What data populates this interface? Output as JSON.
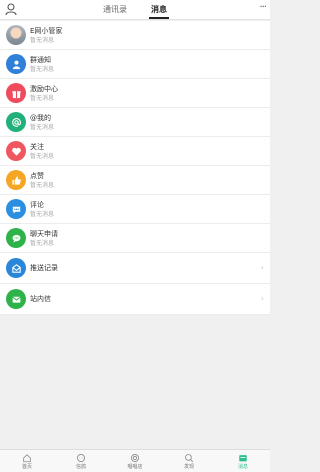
{
  "header": {
    "tabs": [
      {
        "label": "通讯录",
        "active": false
      },
      {
        "label": "消息",
        "active": true
      }
    ],
    "more_label": "···"
  },
  "messages": [
    {
      "title": "E网小管家",
      "subtitle": "暂无消息",
      "icon": "user-photo",
      "color": "#8a949e"
    },
    {
      "title": "群通知",
      "subtitle": "暂无消息",
      "icon": "group-icon",
      "color": "#2f80d8"
    },
    {
      "title": "激励中心",
      "subtitle": "暂无消息",
      "icon": "gift-icon",
      "color": "#ef4b5c"
    },
    {
      "title": "@我的",
      "subtitle": "暂无消息",
      "icon": "at-icon",
      "color": "#22b07a"
    },
    {
      "title": "关注",
      "subtitle": "暂无消息",
      "icon": "heart-icon",
      "color": "#f0565f"
    },
    {
      "title": "点赞",
      "subtitle": "暂无消息",
      "icon": "thumbs-up-icon",
      "color": "#f5a623"
    },
    {
      "title": "评论",
      "subtitle": "暂无消息",
      "icon": "comment-icon",
      "color": "#2a8fe0"
    },
    {
      "title": "聊天申请",
      "subtitle": "暂无消息",
      "icon": "chat-icon",
      "color": "#2db34a"
    }
  ],
  "actions": [
    {
      "title": "推送记录",
      "icon": "push-record-icon",
      "color": "#2a86d8"
    },
    {
      "title": "站内信",
      "icon": "mail-icon",
      "color": "#2db34a"
    }
  ],
  "bottom_nav": [
    {
      "label": "首页",
      "icon": "home-icon",
      "active": false
    },
    {
      "label": "信鸽",
      "icon": "chat-bubble-icon",
      "active": false
    },
    {
      "label": "唱唱店",
      "icon": "circle-icon",
      "active": false
    },
    {
      "label": "发现",
      "icon": "search-icon",
      "active": false
    },
    {
      "label": "消息",
      "icon": "message-icon",
      "active": true
    }
  ],
  "colors": {
    "accent": "#2fbf8c",
    "chevron": "#c8c8c8"
  }
}
